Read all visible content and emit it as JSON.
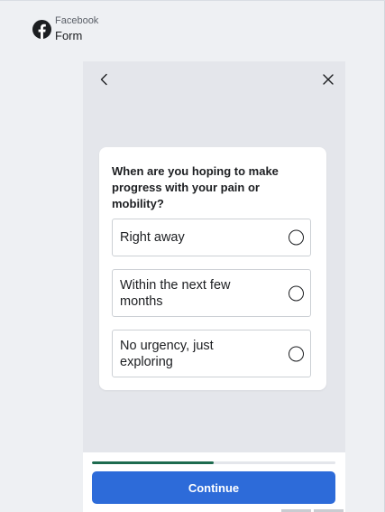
{
  "header": {
    "app_name": "Facebook",
    "subtitle": "Form",
    "logo_icon": "facebook-logo-icon",
    "brand_color": "#1c1e21"
  },
  "preview": {
    "nav": {
      "back_icon": "chevron-left-icon",
      "close_icon": "close-icon"
    },
    "question": "When are you hoping to make progress with your pain or mobility?",
    "options": [
      {
        "label": "Right away",
        "selected": false
      },
      {
        "label": "Within the next few months",
        "selected": false
      },
      {
        "label": "No urgency, just exploring",
        "selected": false
      }
    ],
    "progress": {
      "fraction": 0.5,
      "color": "#1e6b4f"
    },
    "continue_label": "Continue",
    "accent_color": "#2d6bd9"
  }
}
